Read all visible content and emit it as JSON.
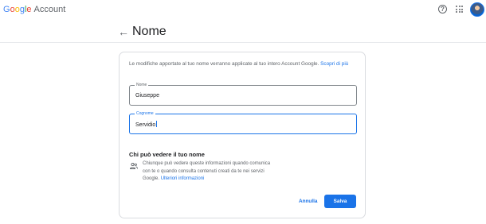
{
  "header": {
    "logo_text": "Google",
    "logo_colors": [
      "#4285F4",
      "#EA4335",
      "#FBBC05",
      "#4285F4",
      "#34A853",
      "#EA4335"
    ],
    "product_label": "Account",
    "help_icon": "help-circle-icon",
    "apps_icon": "apps-grid-icon",
    "avatar_icon": "user-avatar"
  },
  "page": {
    "back_icon": "arrow-back-icon",
    "title": "Nome"
  },
  "card": {
    "intro_text": "Le modifiche apportate al tuo nome verranno applicate al tuo intero Account Google.",
    "intro_link": "Scopri di più",
    "first_name": {
      "label": "Nome",
      "value": "Giuseppe"
    },
    "last_name": {
      "label": "Cognome",
      "value": "Servidio"
    },
    "who_title": "Chi può vedere il tuo nome",
    "who_icon": "people-icon",
    "who_text": "Chiunque può vedere queste informazioni quando comunica con te o quando consulta contenuti creati da te nei servizi Google.",
    "who_link": "Ulteriori informazioni",
    "cancel_label": "Annulla",
    "save_label": "Salva"
  },
  "colors": {
    "accent": "#1a73e8",
    "text": "#202124",
    "secondary_text": "#5f6368",
    "border": "#dadce0"
  }
}
